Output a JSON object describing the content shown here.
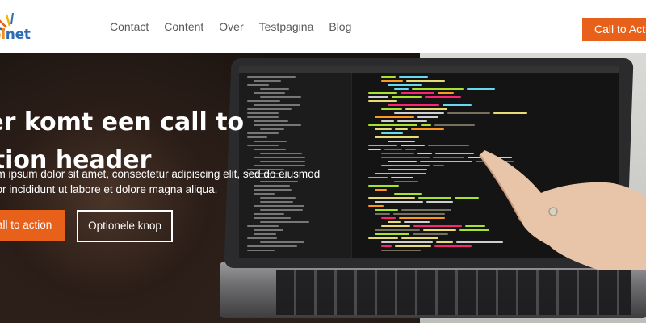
{
  "header": {
    "logo": {
      "part1": "el",
      "part2": "net"
    },
    "nav": [
      {
        "label": "Contact"
      },
      {
        "label": "Content"
      },
      {
        "label": "Over"
      },
      {
        "label": "Testpagina"
      },
      {
        "label": "Blog"
      }
    ],
    "cta_label": "Call to Action"
  },
  "hero": {
    "title": "ier komt een call to ction header",
    "subtitle": "em ipsum dolor sit amet, consectetur adipiscing elit, sed do eiusmod por incididunt ut labore et dolore magna aliqua.",
    "primary_button": "all to action",
    "secondary_button": "Optionele knop"
  },
  "colors": {
    "accent": "#e8611a",
    "logo_orange": "#f28c1b",
    "logo_blue": "#2c6cb5",
    "nav_text": "#5a5a5a"
  }
}
